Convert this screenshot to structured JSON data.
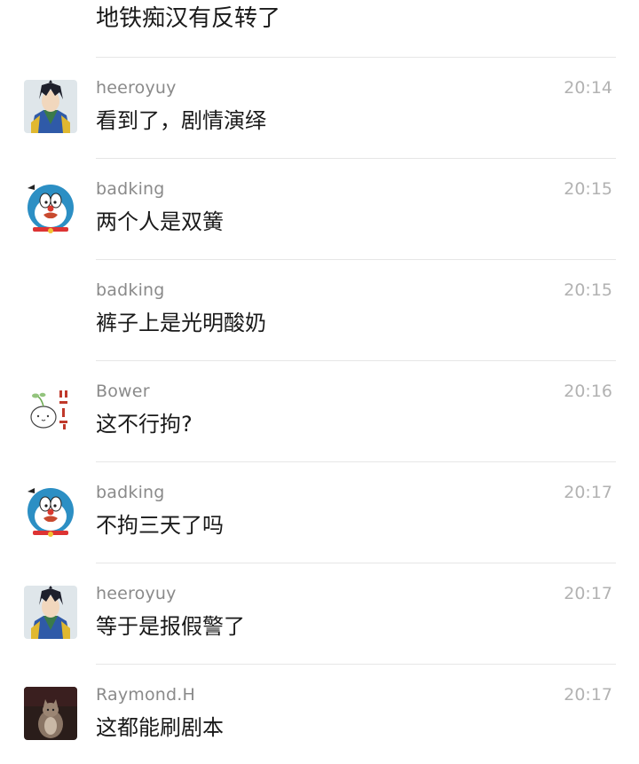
{
  "top_message": "地铁痴汉有反转了",
  "messages": [
    {
      "user": "heeroyuy",
      "time": "20:14",
      "text": "看到了，剧情演绎",
      "avatar": "anime-character-avatar"
    },
    {
      "user": "badking",
      "time": "20:15",
      "text": "两个人是双簧",
      "avatar": "doraemon-avatar"
    },
    {
      "user": "badking",
      "time": "20:15",
      "text": "裤子上是光明酸奶",
      "avatar": ""
    },
    {
      "user": "Bower",
      "time": "20:16",
      "text": "这不行拘?",
      "avatar": "sprout-doodle-avatar"
    },
    {
      "user": "badking",
      "time": "20:17",
      "text": "不拘三天了吗",
      "avatar": "doraemon-avatar"
    },
    {
      "user": "heeroyuy",
      "time": "20:17",
      "text": "等于是报假警了",
      "avatar": "anime-character-avatar"
    },
    {
      "user": "Raymond.H",
      "time": "20:17",
      "text": "这都能刷剧本",
      "avatar": "cat-photo-avatar"
    }
  ],
  "colors": {
    "text": "#1a1a1a",
    "username": "#8a8a8a",
    "time": "#b2b2b2",
    "divider": "#e6e6e6"
  }
}
